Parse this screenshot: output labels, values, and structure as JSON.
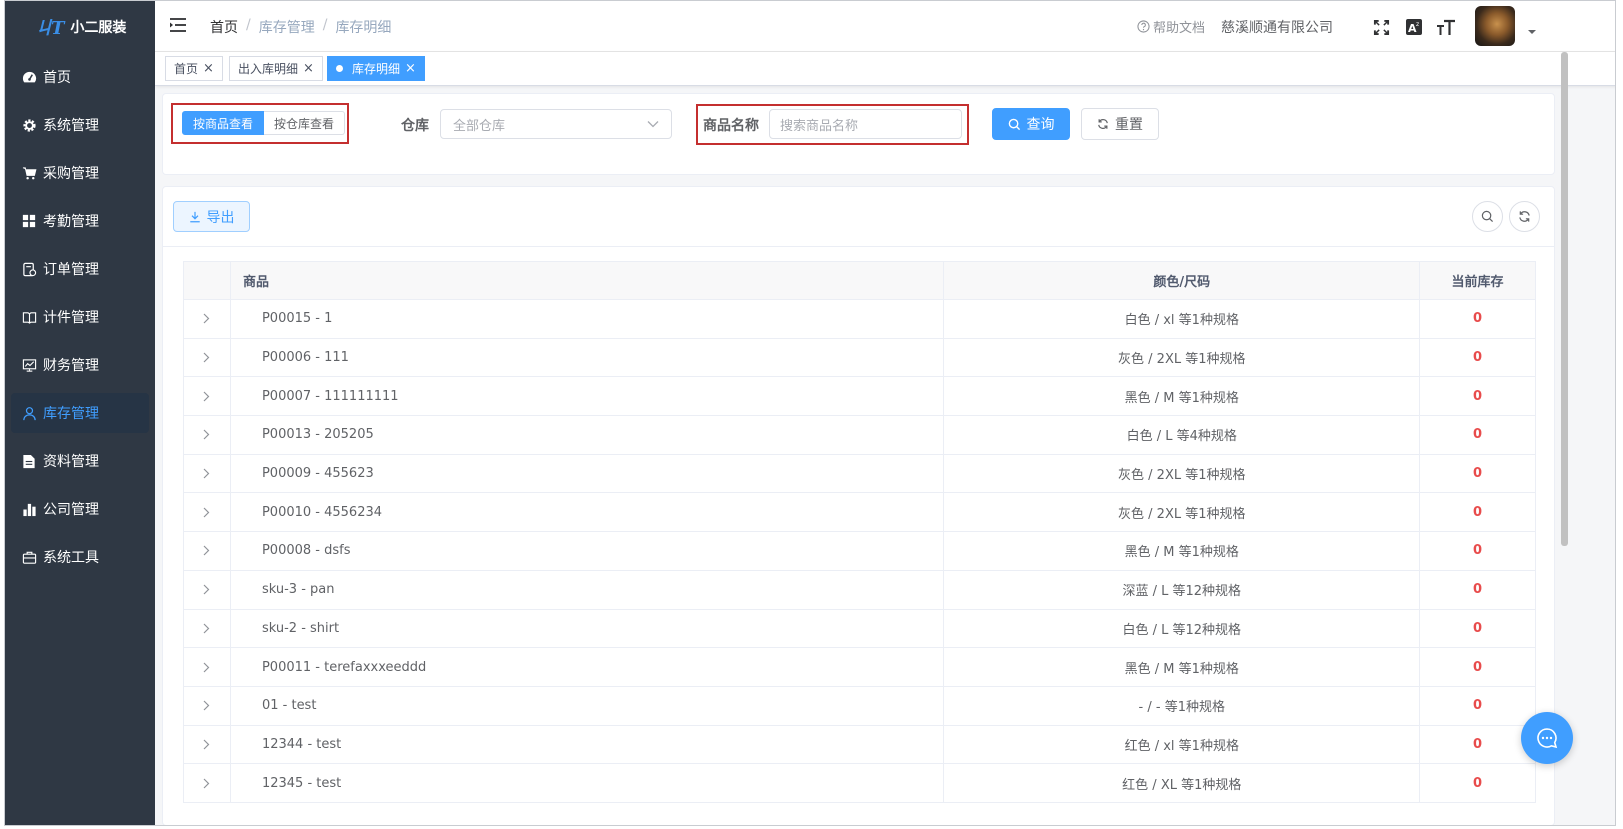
{
  "app": {
    "logo_mark": "ㄐT",
    "title": "小二服装"
  },
  "sidebar": {
    "items": [
      {
        "label": "首页",
        "icon": "dashboard-icon"
      },
      {
        "label": "系统管理",
        "icon": "gear-icon"
      },
      {
        "label": "采购管理",
        "icon": "cart-icon"
      },
      {
        "label": "考勤管理",
        "icon": "grid-icon"
      },
      {
        "label": "订单管理",
        "icon": "order-icon"
      },
      {
        "label": "计件管理",
        "icon": "book-icon"
      },
      {
        "label": "财务管理",
        "icon": "monitor-chart-icon"
      },
      {
        "label": "库存管理",
        "icon": "user-icon",
        "active": true
      },
      {
        "label": "资料管理",
        "icon": "document-icon"
      },
      {
        "label": "公司管理",
        "icon": "bar-chart-icon"
      },
      {
        "label": "系统工具",
        "icon": "toolbox-icon"
      }
    ]
  },
  "header": {
    "breadcrumb": [
      "首页",
      "库存管理",
      "库存明细"
    ],
    "breadcrumb_sep": "/",
    "help": "帮助文档",
    "company": "慈溪顺通有限公司"
  },
  "tags": [
    {
      "label": "首页",
      "active": false
    },
    {
      "label": "出入库明细",
      "active": false
    },
    {
      "label": "库存明细",
      "active": true
    }
  ],
  "search": {
    "view_by_product": "按商品查看",
    "view_by_warehouse": "按仓库查看",
    "warehouse_label": "仓库",
    "warehouse_placeholder": "全部仓库",
    "name_label": "商品名称",
    "name_placeholder": "搜索商品名称",
    "query_btn": "查询",
    "reset_btn": "重置"
  },
  "toolbar": {
    "export_btn": "导出"
  },
  "table": {
    "columns": [
      "商品",
      "颜色/尺码",
      "当前库存"
    ],
    "rows": [
      {
        "product": "P00015 - 1",
        "spec": "白色 / xl 等1种规格",
        "stock": "0"
      },
      {
        "product": "P00006 - 111",
        "spec": "灰色 / 2XL 等1种规格",
        "stock": "0"
      },
      {
        "product": "P00007 - 111111111",
        "spec": "黑色 / M 等1种规格",
        "stock": "0"
      },
      {
        "product": "P00013 - 205205",
        "spec": "白色 / L 等4种规格",
        "stock": "0"
      },
      {
        "product": "P00009 - 455623",
        "spec": "灰色 / 2XL 等1种规格",
        "stock": "0"
      },
      {
        "product": "P00010 - 4556234",
        "spec": "灰色 / 2XL 等1种规格",
        "stock": "0"
      },
      {
        "product": "P00008 - dsfs",
        "spec": "黑色 / M 等1种规格",
        "stock": "0"
      },
      {
        "product": "sku-3 - pan",
        "spec": "深蓝 / L 等12种规格",
        "stock": "0"
      },
      {
        "product": "sku-2 - shirt",
        "spec": "白色 / L 等12种规格",
        "stock": "0"
      },
      {
        "product": "P00011 - terefaxxxeeddd",
        "spec": "黑色 / M 等1种规格",
        "stock": "0"
      },
      {
        "product": "01 - test",
        "spec": "- / - 等1种规格",
        "stock": "0"
      },
      {
        "product": "12344 - test",
        "spec": "红色 / xl 等1种规格",
        "stock": "0"
      },
      {
        "product": "12345 - test",
        "spec": "红色 / XL 等1种规格",
        "stock": "0"
      }
    ]
  },
  "colors": {
    "primary": "#409eff",
    "sidebar_bg": "#2f3844",
    "stock_red": "#e84b4b",
    "highlight_box": "#c42f2f"
  }
}
